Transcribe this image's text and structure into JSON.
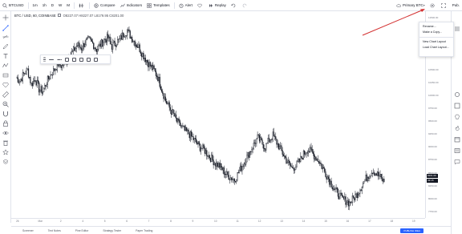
{
  "topbar": {
    "symbol": "BTCUSD",
    "intervals": [
      "1m",
      "1h",
      "D",
      "W",
      "M"
    ],
    "compare_label": "Compare",
    "indicators_label": "Indicators",
    "templates_label": "Templates",
    "alert_label": "Alert",
    "replay_label": "Replay",
    "layout_name": "Primary BTC",
    "publish_label": "Pub."
  },
  "legend": {
    "title": "BTC / USD, 60, COINBASE",
    "ohlc": "O8227.07  H8227.07  L8179.95  C8201.00"
  },
  "menu": {
    "items": [
      "Rename...",
      "Make a Copy...",
      "New Chart Layout",
      "Load Chart Layout..."
    ]
  },
  "pricescale": {
    "labels": [
      "11500.00",
      "11250.00",
      "11000.00",
      "10750.00",
      "10500.00",
      "10250.00",
      "10000.00",
      "9750.00",
      "9500.00",
      "9250.00",
      "9000.00",
      "8750.00",
      "8500.00",
      "8250.00",
      "8000.00",
      "7750.00"
    ],
    "last_price": "8201.00",
    "last_time": "43:15"
  },
  "timescale": {
    "labels": [
      "26",
      "Mar",
      "2",
      "4",
      "5",
      "6",
      "7",
      "8",
      "9",
      "10",
      "11",
      "12",
      "13",
      "14",
      "15",
      "16",
      "17",
      "18",
      "19"
    ]
  },
  "bottom": {
    "tabs": [
      "Screener",
      "Text Notes",
      "Pine Editor",
      "Strategy Tester",
      "Paper Trading"
    ],
    "action_button": "PUBLISH IDEA"
  },
  "right_widgets": [
    "Watchlist",
    "Alerts",
    "Details",
    "Ideas",
    "Hotlist",
    "Calendar",
    "News",
    "Chat"
  ],
  "colors": {
    "candles": "#131722",
    "annotation_arrow": "#d32f2f",
    "last_price_tag": "#131722",
    "accent": "#2962ff"
  },
  "chart_data": {
    "type": "candlestick",
    "symbol": "BTC / USD",
    "interval": "60",
    "exchange": "COINBASE",
    "ylim": [
      7600,
      11700
    ],
    "close_series": [
      10450,
      10380,
      10520,
      10610,
      10300,
      10420,
      10200,
      10150,
      10350,
      10500,
      10620,
      10740,
      10690,
      10810,
      10930,
      11020,
      11150,
      11080,
      11200,
      11250,
      11180,
      11050,
      11150,
      11260,
      11300,
      11120,
      11200,
      11250,
      11380,
      11450,
      11320,
      11200,
      11100,
      10950,
      10820,
      10700,
      10600,
      10450,
      10200,
      9950,
      9800,
      9650,
      9500,
      9400,
      9300,
      9250,
      9150,
      9050,
      8950,
      8900,
      8800,
      8700,
      8600,
      8550,
      8450,
      8350,
      8300,
      8250,
      8400,
      8550,
      8700,
      8850,
      9000,
      9150,
      9050,
      8950,
      9100,
      9200,
      9050,
      8900,
      8750,
      8600,
      8500,
      8550,
      8650,
      8800,
      8900,
      8850,
      8750,
      8650,
      8500,
      8350,
      8200,
      8050,
      7950,
      7850,
      7800,
      7750,
      7850,
      7950,
      8100,
      8250,
      8350,
      8450,
      8380,
      8300,
      8201
    ]
  }
}
